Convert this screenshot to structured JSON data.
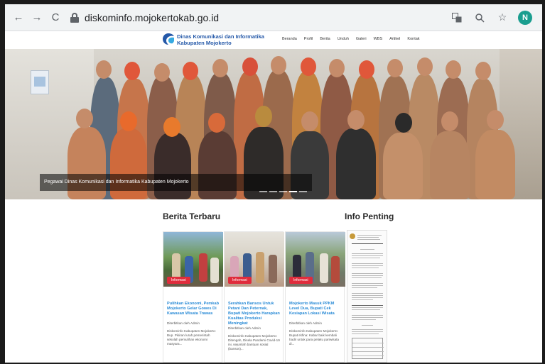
{
  "browser": {
    "url": "diskominfo.mojokertokab.go.id",
    "back_icon": "←",
    "forward_icon": "→",
    "reload_icon": "C",
    "profile_initial": "N"
  },
  "site": {
    "brand_line1": "Dinas Komunikasi dan Informatika",
    "brand_line2": "Kabupaten Mojokerto",
    "nav": [
      "Beranda",
      "Profil",
      "Berita",
      "Unduh",
      "Galeri",
      "WBS",
      "Artikel",
      "Kontak"
    ]
  },
  "hero": {
    "caption": "Pegawai Dinas Komunikasi dan Informatika Kabupaten Mojokerto"
  },
  "berita": {
    "title": "Berita Terbaru",
    "cards": [
      {
        "badge": "Informasi",
        "title": "Pulihkan Ekonomi, Pemkab Mojokerto Gelar Gowes Di Kawasan Wisata Trawas",
        "author": "Diterbitkan oleh Admin",
        "excerpt": "Diskominfo Kabupaten Mojokerto-Bup. Pikiran lurah pemerintah sekolah pemulihan ekonomi masyara..."
      },
      {
        "badge": "Informasi",
        "title": "Serahkan Bansos Untuk Petani Dan Peternak, Bupati Mojokerto Harapkan Kualitas Produksi Meningkat",
        "author": "Diterbitkan oleh Admin",
        "excerpt": "Diskominfo Kabupaten Mojokerto: Ditengah, Disela Pandemi Covid-19 ini, sejumlah bantuan sosial (bansos)..."
      },
      {
        "badge": "Informasi",
        "title": "Mojokerto Masuk PPKM Level Dua, Bupati Cek Kesiapan Lokasi Wisata",
        "author": "Diterbitkan oleh Admin",
        "excerpt": "Diskominfo Kabupaten Mojokerto-Bupati Ikfina: Kabar baik kembali hadir untuk para pelaku pariwisata di..."
      }
    ]
  },
  "info": {
    "title": "Info Penting"
  }
}
